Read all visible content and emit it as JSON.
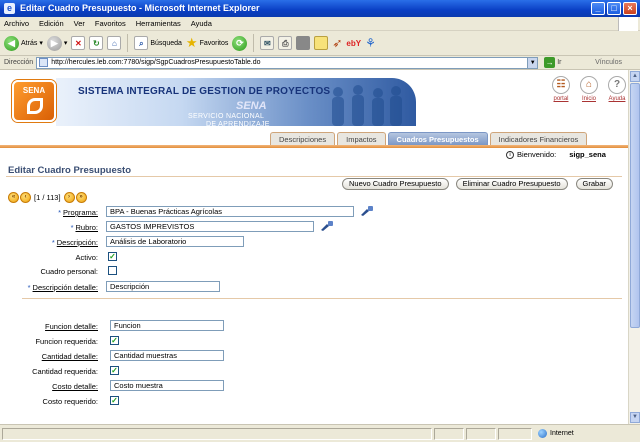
{
  "window": {
    "title": "Editar Cuadro Presupuesto - Microsoft Internet Explorer"
  },
  "menu": [
    "Archivo",
    "Edición",
    "Ver",
    "Favoritos",
    "Herramientas",
    "Ayuda"
  ],
  "toolbar": {
    "back": "Atrás",
    "search": "Búsqueda",
    "favorites": "Favoritos"
  },
  "address": {
    "label": "Dirección",
    "url": "http://hercules.leb.com:7780/sigp/SgpCuadrosPresupuestoTable.do",
    "go": "Ir",
    "links": "Vínculos"
  },
  "banner": {
    "logo": "SENA",
    "system_title": "SISTEMA INTEGRAL DE GESTION DE PROYECTOS",
    "sena_watermark": "SENA",
    "servicio_line1": "SERVICIO NACIONAL",
    "servicio_line2": "DE APRENDIZAJE"
  },
  "tools": [
    {
      "label": "portal"
    },
    {
      "label": "Inicio"
    },
    {
      "label": "Ayuda"
    }
  ],
  "tabs": [
    {
      "label": "Descripciones",
      "active": false
    },
    {
      "label": "Impactos",
      "active": false
    },
    {
      "label": "Cuadros Presupuestos",
      "active": true
    },
    {
      "label": "Indicadores Financieros",
      "active": false
    }
  ],
  "user": {
    "welcome": "Bienvenido:",
    "name": "sigp_sena"
  },
  "page": {
    "title": "Editar Cuadro Presupuesto"
  },
  "pager": {
    "text": "[1 / 113]"
  },
  "actions": {
    "new": "Nuevo Cuadro Presupuesto",
    "delete": "Eliminar Cuadro Presupuesto",
    "save": "Grabar"
  },
  "form": {
    "programa": {
      "label": "Programa:",
      "value": "BPA - Buenas Prácticas Agrícolas"
    },
    "rubro": {
      "label": "Rubro:",
      "value": "GASTOS IMPREVISTOS"
    },
    "descripcion": {
      "label": "Descripción:",
      "value": "Análisis de Laboratorio"
    },
    "activo": {
      "label": "Activo:",
      "checked": true
    },
    "cuadro_personal": {
      "label": "Cuadro personal:",
      "checked": false
    },
    "descripcion_detalle": {
      "label": "Descripción detalle:",
      "value": "Descripción"
    },
    "funcion_detalle": {
      "label": "Funcion detalle:",
      "value": "Funcion"
    },
    "funcion_requerida": {
      "label": "Funcion requerida:",
      "checked": true
    },
    "cantidad_detalle": {
      "label": "Cantidad detalle:",
      "value": "Cantidad muestras"
    },
    "cantidad_requerida": {
      "label": "Cantidad requerida:",
      "checked": true
    },
    "costo_detalle": {
      "label": "Costo detalle:",
      "value": "Costo muestra"
    },
    "costo_requerido": {
      "label": "Costo requerido:",
      "checked": true
    }
  },
  "status": {
    "zone": "Internet"
  }
}
